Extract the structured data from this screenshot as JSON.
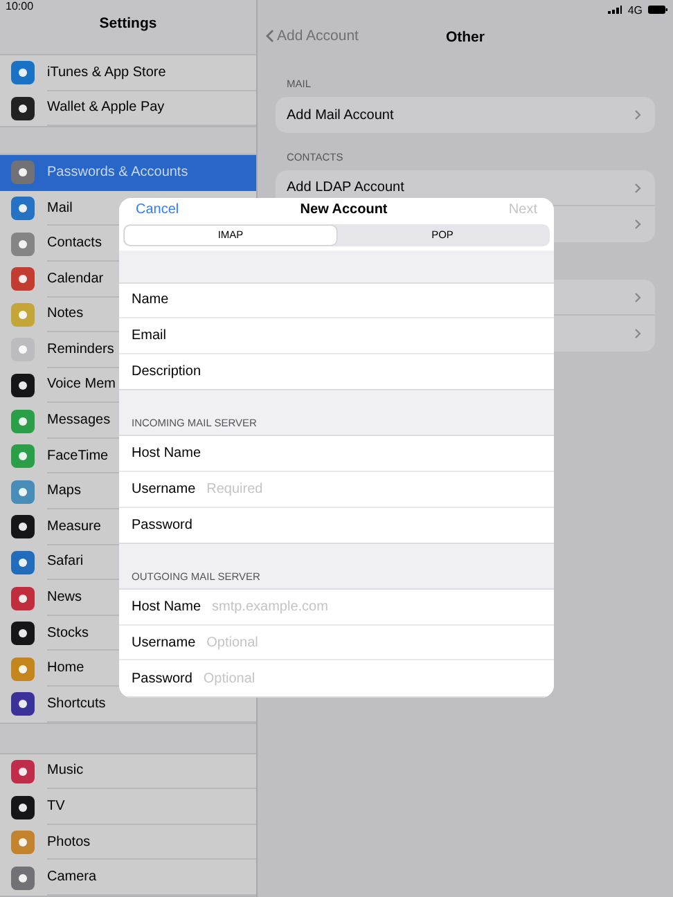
{
  "status_bar": {
    "time": "10:00",
    "network": "4G"
  },
  "sidebar": {
    "title": "Settings",
    "groups": [
      {
        "items": [
          {
            "label": "iTunes & App Store",
            "color": "#1a72c4",
            "selected": false
          },
          {
            "label": "Wallet & Apple Pay",
            "color": "#222222",
            "selected": false
          }
        ]
      },
      {
        "items": [
          {
            "label": "Passwords & Accounts",
            "color": "#727276",
            "selected": true
          },
          {
            "label": "Mail",
            "color": "#2672c2",
            "selected": false
          },
          {
            "label": "Contacts",
            "color": "#858585",
            "selected": false
          },
          {
            "label": "Calendar",
            "color": "#c23c32",
            "selected": false
          },
          {
            "label": "Notes",
            "color": "#c4a638",
            "selected": false
          },
          {
            "label": "Reminders",
            "color": "#bcbcc0",
            "selected": false
          },
          {
            "label": "Voice Mem",
            "color": "#161618",
            "selected": false
          },
          {
            "label": "Messages",
            "color": "#2a9f47",
            "selected": false
          },
          {
            "label": "FaceTime",
            "color": "#2a9f47",
            "selected": false
          },
          {
            "label": "Maps",
            "color": "#488cb8",
            "selected": false
          },
          {
            "label": "Measure",
            "color": "#161618",
            "selected": false
          },
          {
            "label": "Safari",
            "color": "#226cbc",
            "selected": false
          },
          {
            "label": "News",
            "color": "#c02d3d",
            "selected": false
          },
          {
            "label": "Stocks",
            "color": "#161618",
            "selected": false
          },
          {
            "label": "Home",
            "color": "#c4851c",
            "selected": false
          },
          {
            "label": "Shortcuts",
            "color": "#3b3299",
            "selected": false
          }
        ]
      },
      {
        "items": [
          {
            "label": "Music",
            "color": "#c02d4a",
            "selected": false
          },
          {
            "label": "TV",
            "color": "#161618",
            "selected": false
          },
          {
            "label": "Photos",
            "color": "#c2822e",
            "selected": false
          },
          {
            "label": "Camera",
            "color": "#727276",
            "selected": false
          }
        ]
      }
    ]
  },
  "detail": {
    "back": "Add Account",
    "title": "Other",
    "sections": [
      {
        "header": "MAIL",
        "rows": [
          {
            "label": "Add Mail Account"
          }
        ]
      },
      {
        "header": "CONTACTS",
        "rows": [
          {
            "label": "Add LDAP Account"
          },
          {}
        ]
      },
      {
        "rows": [
          {},
          {}
        ]
      }
    ]
  },
  "dialog": {
    "cancel": "Cancel",
    "title": "New Account",
    "next": "Next",
    "next_disabled": true,
    "tabs": [
      {
        "label": "IMAP",
        "selected": true
      },
      {
        "label": "POP",
        "selected": false
      }
    ],
    "sections": [
      {
        "fields": [
          {
            "label": "Name"
          },
          {
            "label": "Email"
          },
          {
            "label": "Description"
          }
        ]
      },
      {
        "header": "INCOMING MAIL SERVER",
        "fields": [
          {
            "label": "Host Name"
          },
          {
            "label": "Username",
            "placeholder": "Required"
          },
          {
            "label": "Password"
          }
        ]
      },
      {
        "header": "OUTGOING MAIL SERVER",
        "fields": [
          {
            "label": "Host Name",
            "placeholder": "smtp.example.com"
          },
          {
            "label": "Username",
            "placeholder": "Optional"
          },
          {
            "label": "Password",
            "placeholder": "Optional"
          }
        ]
      }
    ]
  }
}
